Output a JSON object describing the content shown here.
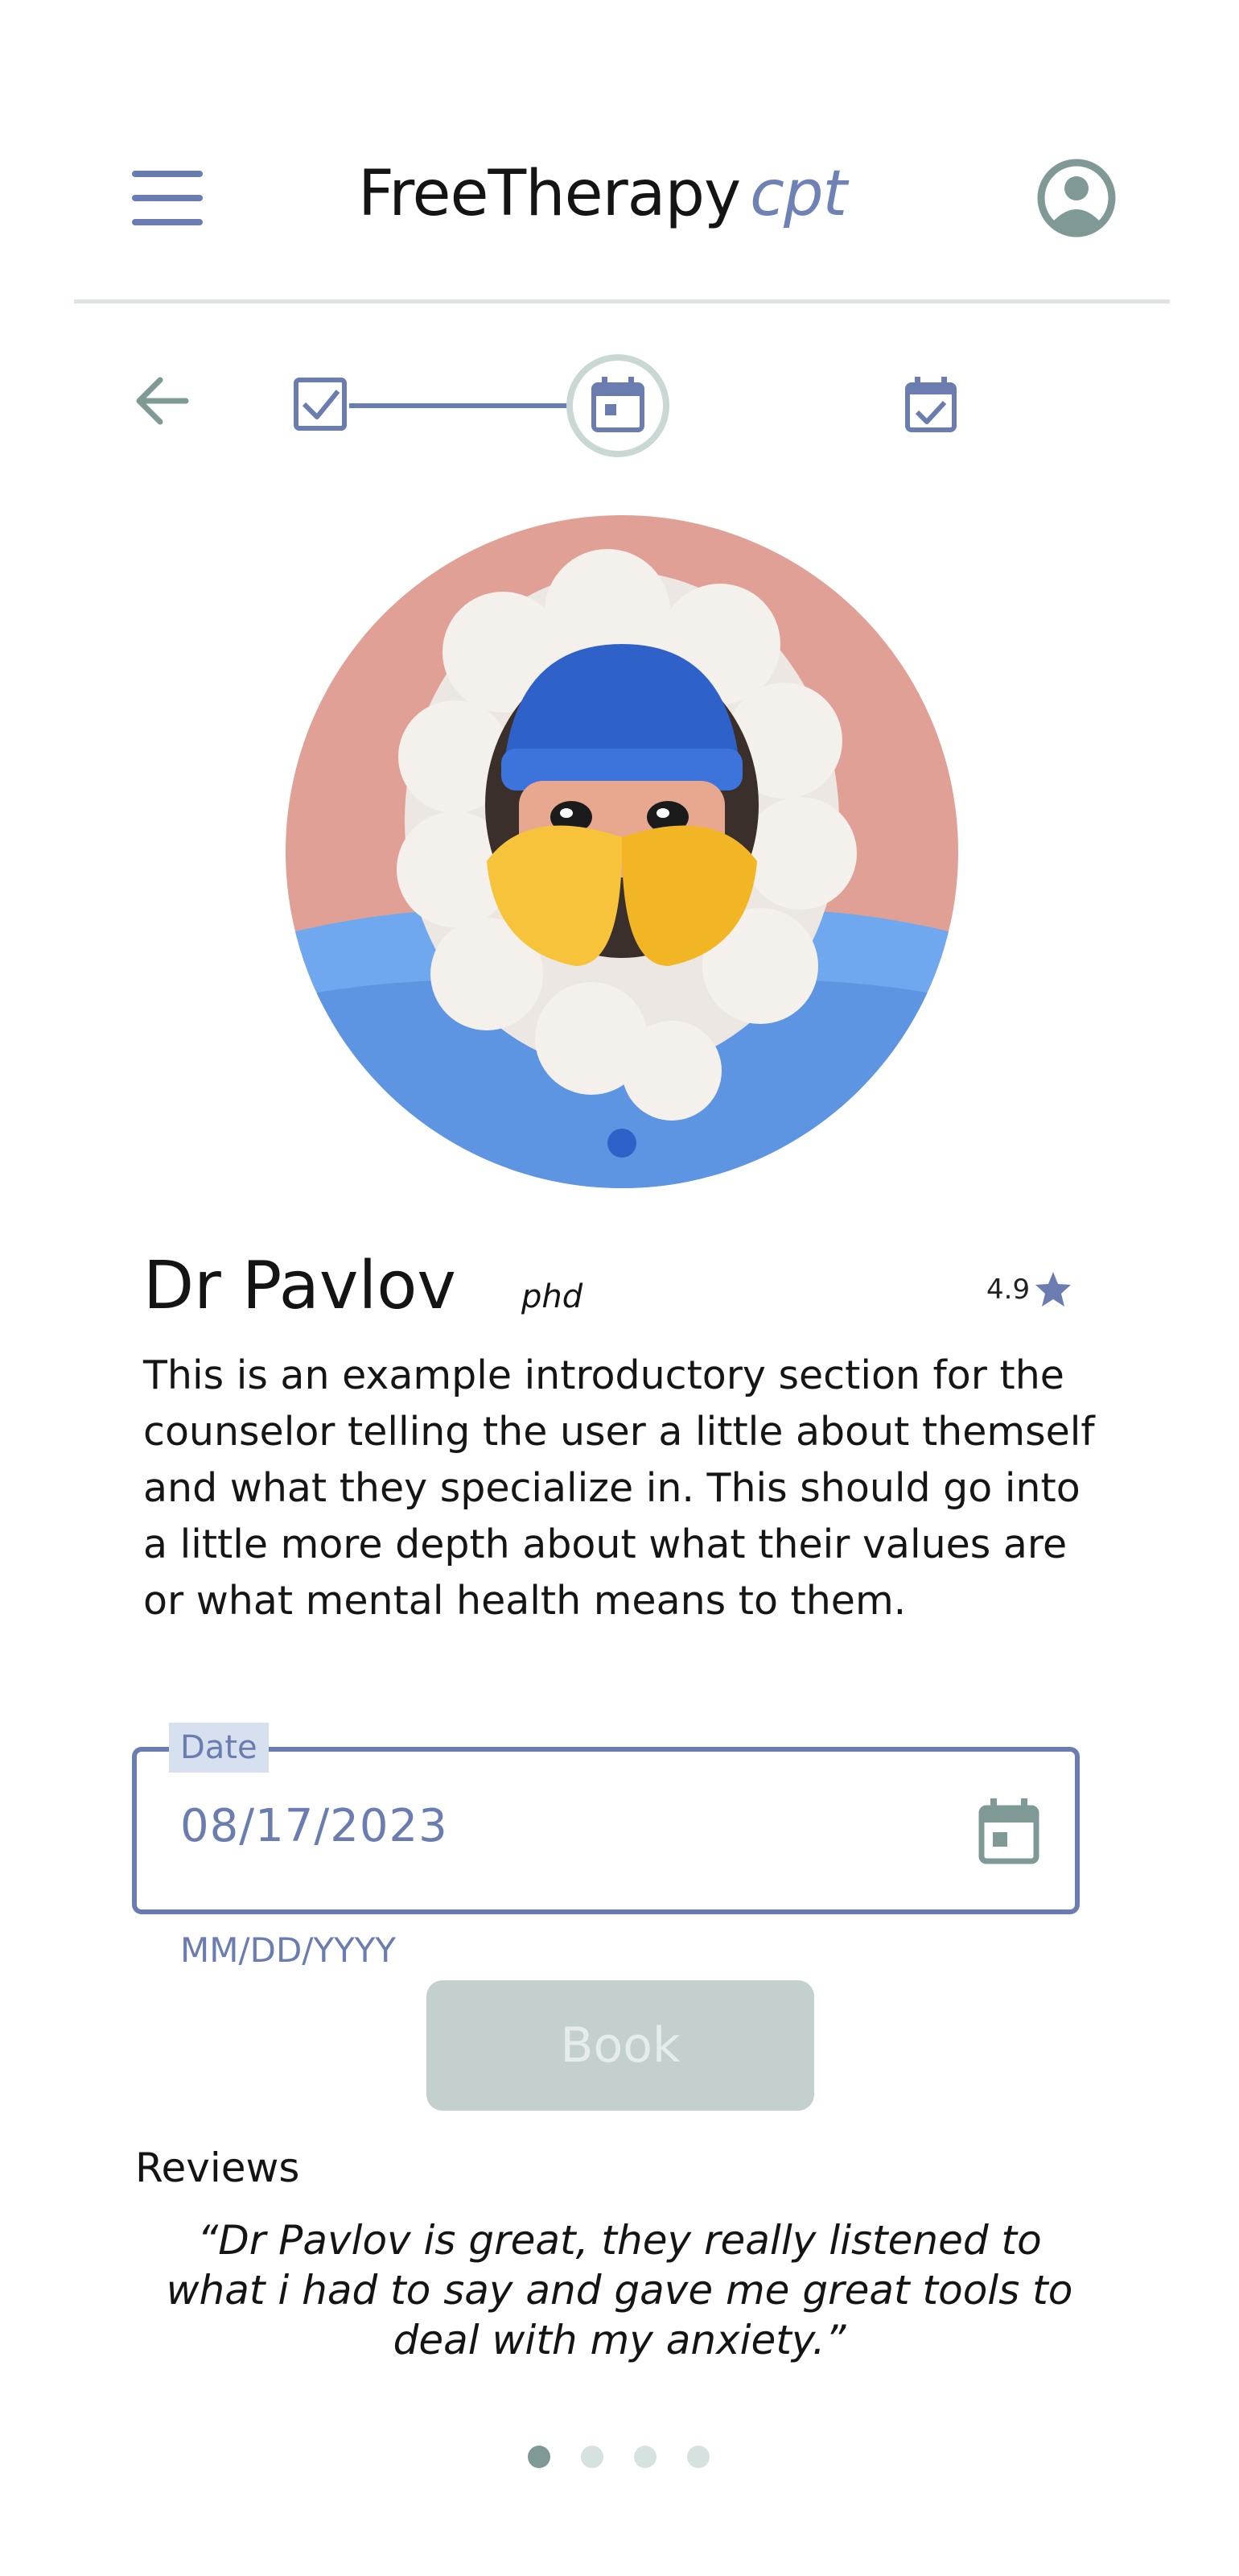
{
  "header": {
    "title": "FreeTherapy",
    "title_suffix": "cpt",
    "menu_icon": "menu-icon",
    "account_icon": "account-circle-icon"
  },
  "stepper": {
    "back_icon": "arrow-back-icon",
    "steps": [
      {
        "icon": "checkbox-icon",
        "state": "complete"
      },
      {
        "icon": "calendar-icon",
        "state": "current"
      },
      {
        "icon": "calendar-check-icon",
        "state": "upcoming"
      }
    ]
  },
  "counselor": {
    "name": "Dr Pavlov",
    "degree": "phd",
    "rating": "4.9",
    "rating_icon": "star-icon",
    "bio": "This is an example introductory section for the counselor telling the user a little about themself and what they specialize in. This should go into a little more depth about what their values are or what mental health means to them."
  },
  "date_field": {
    "label": "Date",
    "value": "08/17/2023",
    "hint": "MM/DD/YYYY",
    "icon": "calendar-icon"
  },
  "book_button": {
    "label": "Book",
    "disabled": true
  },
  "reviews": {
    "title": "Reviews",
    "quote": "“Dr Pavlov is great, they really listened to what i had to say and gave me great tools to deal with my anxiety.”",
    "pagination": {
      "total": 4,
      "active_index": 0
    }
  },
  "colors": {
    "accent": "#6a7cb0",
    "muted_green": "#7f9996",
    "button_disabled": "#c3d0ce",
    "avatar_bg": "#e1a096"
  }
}
